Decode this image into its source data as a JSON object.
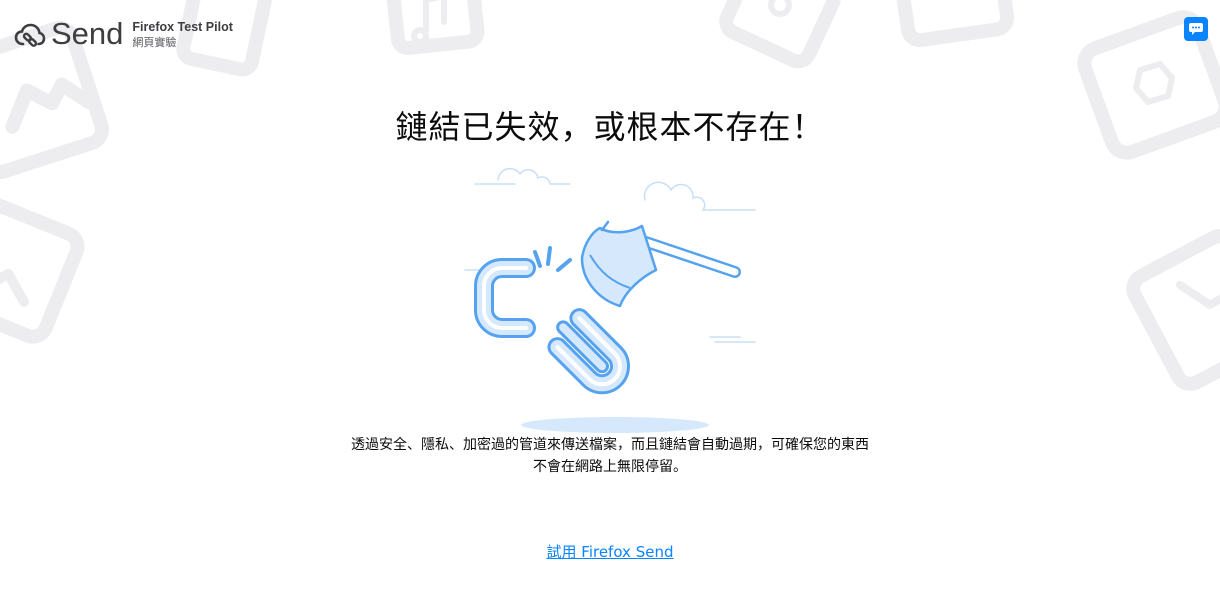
{
  "header": {
    "brand": "Send",
    "pilot_title": "Firefox Test Pilot",
    "pilot_subtitle": "網頁實驗"
  },
  "feedback_icon": "chat-bubble-icon",
  "main": {
    "title": "鏈結已失效，或根本不存在！",
    "description_line1": "透過安全、隱私、加密過的管道來傳送檔案，而且鏈結會自動過期，可確保您的東西",
    "description_line2": "不會在網路上無限停留。",
    "cta_label": "試用 Firefox Send"
  },
  "colors": {
    "accent": "#0a84ff",
    "illustration_stroke": "#55a2ef",
    "illustration_fill": "#d6e8fc",
    "background_pattern": "#ededf0"
  },
  "icons": {
    "logo": "send-cloud-icon",
    "illustration": "broken-link-axe-icon"
  }
}
